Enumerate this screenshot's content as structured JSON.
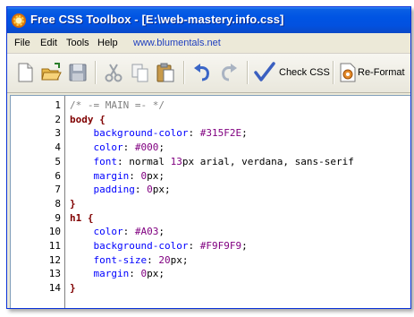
{
  "window": {
    "title": "Free CSS Toolbox - [E:\\web-mastery.info.css]"
  },
  "menu": {
    "items": [
      "File",
      "Edit",
      "Tools",
      "Help"
    ],
    "link": "www.blumentals.net"
  },
  "toolbar": {
    "buttons": [
      {
        "name": "new-file-icon"
      },
      {
        "name": "open-folder-icon"
      },
      {
        "name": "save-icon"
      },
      {
        "name": "cut-icon"
      },
      {
        "name": "copy-icon"
      },
      {
        "name": "paste-icon"
      },
      {
        "name": "undo-icon"
      },
      {
        "name": "redo-icon"
      },
      {
        "name": "check-css-icon"
      },
      {
        "name": "reformat-icon"
      }
    ],
    "check_css_label": "Check CSS",
    "reformat_label": "Re-Format"
  },
  "editor": {
    "lines": [
      {
        "n": "1",
        "parts": [
          {
            "t": "/* -= MAIN =- */",
            "c": "comment"
          }
        ]
      },
      {
        "n": "2",
        "parts": [
          {
            "t": "body",
            "c": "sel"
          },
          {
            "t": " {",
            "c": "sel"
          }
        ]
      },
      {
        "n": "3",
        "parts": [
          {
            "t": "    background-color",
            "c": "prop"
          },
          {
            "t": ": ",
            "c": "punc"
          },
          {
            "t": "#315F2E",
            "c": "val"
          },
          {
            "t": ";",
            "c": "punc"
          }
        ]
      },
      {
        "n": "4",
        "parts": [
          {
            "t": "    color",
            "c": "prop"
          },
          {
            "t": ": ",
            "c": "punc"
          },
          {
            "t": "#000",
            "c": "val"
          },
          {
            "t": ";",
            "c": "punc"
          }
        ]
      },
      {
        "n": "5",
        "parts": [
          {
            "t": "    font",
            "c": "prop"
          },
          {
            "t": ": normal ",
            "c": "punc"
          },
          {
            "t": "13",
            "c": "val"
          },
          {
            "t": "px arial, verdana, sans-serif",
            "c": "punc"
          }
        ]
      },
      {
        "n": "6",
        "parts": [
          {
            "t": "    margin",
            "c": "prop"
          },
          {
            "t": ": ",
            "c": "punc"
          },
          {
            "t": "0",
            "c": "val"
          },
          {
            "t": "px;",
            "c": "punc"
          }
        ]
      },
      {
        "n": "7",
        "parts": [
          {
            "t": "    padding",
            "c": "prop"
          },
          {
            "t": ": ",
            "c": "punc"
          },
          {
            "t": "0",
            "c": "val"
          },
          {
            "t": "px;",
            "c": "punc"
          }
        ]
      },
      {
        "n": "8",
        "parts": [
          {
            "t": "}",
            "c": "sel"
          }
        ]
      },
      {
        "n": "9",
        "parts": [
          {
            "t": "h1",
            "c": "sel"
          },
          {
            "t": " {",
            "c": "sel"
          }
        ]
      },
      {
        "n": "10",
        "parts": [
          {
            "t": "    color",
            "c": "prop"
          },
          {
            "t": ": ",
            "c": "punc"
          },
          {
            "t": "#A03",
            "c": "val"
          },
          {
            "t": ";",
            "c": "punc"
          }
        ]
      },
      {
        "n": "11",
        "parts": [
          {
            "t": "    background-color",
            "c": "prop"
          },
          {
            "t": ": ",
            "c": "punc"
          },
          {
            "t": "#F9F9F9",
            "c": "val"
          },
          {
            "t": ";",
            "c": "punc"
          }
        ]
      },
      {
        "n": "12",
        "parts": [
          {
            "t": "    font-size",
            "c": "prop"
          },
          {
            "t": ": ",
            "c": "punc"
          },
          {
            "t": "20",
            "c": "val"
          },
          {
            "t": "px;",
            "c": "punc"
          }
        ]
      },
      {
        "n": "13",
        "parts": [
          {
            "t": "    margin",
            "c": "prop"
          },
          {
            "t": ": ",
            "c": "punc"
          },
          {
            "t": "0",
            "c": "val"
          },
          {
            "t": "px;",
            "c": "punc"
          }
        ]
      },
      {
        "n": "14",
        "parts": [
          {
            "t": "}",
            "c": "sel"
          }
        ]
      }
    ]
  }
}
